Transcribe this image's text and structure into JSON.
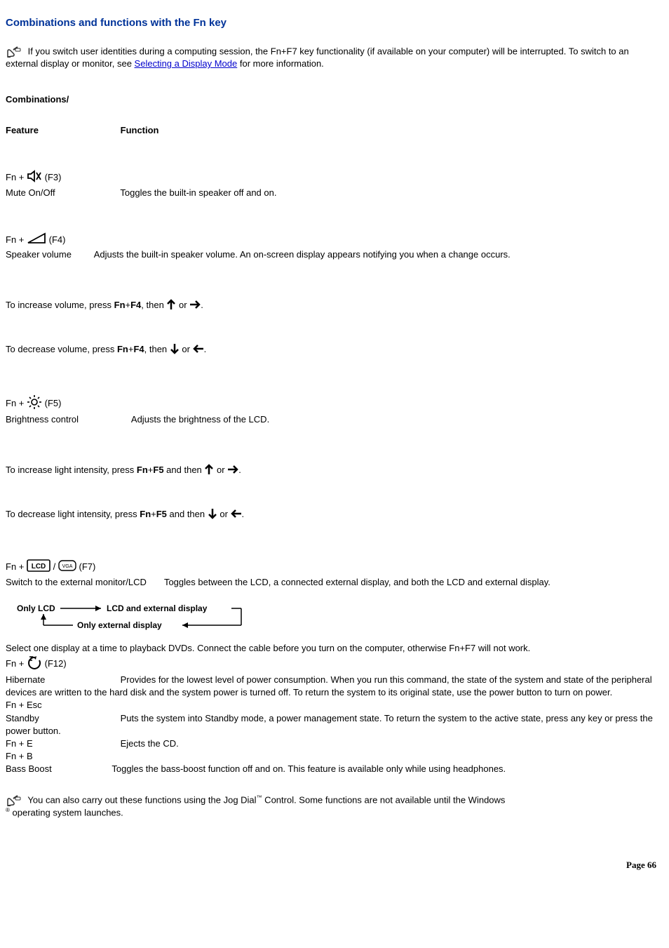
{
  "title": "Combinations and functions with the Fn key",
  "note1": {
    "pre": " If you switch user identities during a computing session, the Fn+F7 key functionality (if available on your computer) will be interrupted. To switch to an external display or monitor, see ",
    "link": "Selecting a Display Mode",
    "post": " for more information."
  },
  "heading_combos": "Combinations/",
  "heading_feature": "Feature",
  "heading_function": "Function",
  "mute": {
    "prefix": "Fn + ",
    "key": "(F3)",
    "feature": "Mute On/Off",
    "function": "Toggles the built-in speaker off and on."
  },
  "speaker": {
    "prefix": "Fn + ",
    "key": "(F4)",
    "feature": "Speaker volume",
    "function": "Adjusts the built-in speaker volume. An on-screen display appears notifying you when a change occurs."
  },
  "volume_inc": {
    "pre": "To increase volume, press ",
    "bold": "Fn",
    "plus": "+",
    "bold2": "F4",
    "mid": ", then ",
    "or": "or ",
    "post": "."
  },
  "volume_dec": {
    "pre": "To decrease volume, press ",
    "bold": "Fn",
    "plus": "+",
    "bold2": "F4",
    "mid": ", then ",
    "or": "or ",
    "post": "."
  },
  "brightness": {
    "prefix": "Fn + ",
    "key": "(F5)",
    "feature": "Brightness control",
    "function": "Adjusts the brightness of the LCD."
  },
  "light_inc": {
    "pre": "To increase light intensity, press ",
    "bold": "Fn",
    "plus": "+",
    "bold2": "F5",
    "mid": " and then ",
    "or": "or ",
    "post": "."
  },
  "light_dec": {
    "pre": "To decrease light intensity, press ",
    "bold": "Fn",
    "plus": "+",
    "bold2": "F5",
    "mid": " and then ",
    "or": "or ",
    "post": "."
  },
  "display": {
    "prefix": "Fn + ",
    "slash": " / ",
    "key": " (F7)",
    "feature": "Switch to the external monitor/LCD",
    "function": "Toggles between the LCD, a connected external display, and both the LCD and external display."
  },
  "diagram": {
    "only_lcd": "Only LCD",
    "both": "LCD and external display",
    "only_ext": "Only external display"
  },
  "display_note": "Select one display at a time to playback DVDs. Connect the cable before you turn on the computer, otherwise Fn+F7 will not work.",
  "hibernate": {
    "prefix": "Fn + ",
    "key": "(F12)",
    "feature": "Hibernate",
    "function": "Provides for the lowest level of power consumption. When you run this command, the state of the system and state of the peripheral devices are written to the hard disk and the system power is turned off. To return the system to its original state, use the power button to turn on power."
  },
  "standby": {
    "line1": "Fn + Esc",
    "feature": "Standby",
    "function": "Puts the system into Standby mode, a power management state. To return the system to the active state, press any key or press the power button."
  },
  "eject": {
    "line1": "Fn + E",
    "function": "Ejects the CD."
  },
  "bass": {
    "line1": "Fn + B",
    "feature": "Bass Boost",
    "function": "Toggles the bass-boost function off and on. This feature is available only while using headphones."
  },
  "note2": {
    "pre": " You can also carry out these functions using the Jog Dial",
    "mid": " Control. Some functions are not available until the Windows",
    "post": " operating system launches."
  },
  "page_label": "Page ",
  "page_number": "66"
}
